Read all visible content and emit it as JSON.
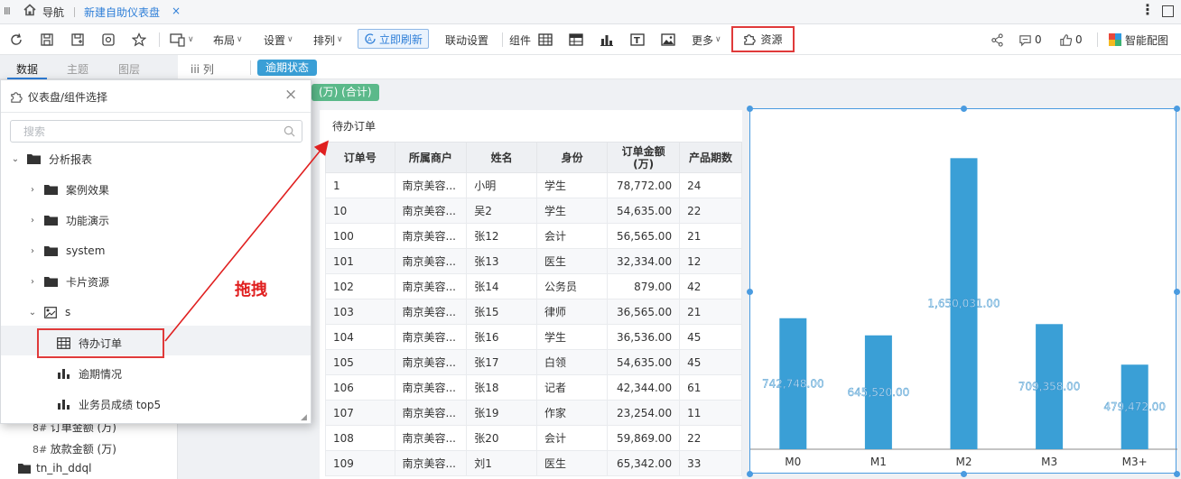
{
  "titlebar": {
    "nav_label": "导航",
    "tab_label": "新建自助仪表盘",
    "tab_close": "×"
  },
  "toolbar": {
    "layout": "布局",
    "settings": "设置",
    "arrange": "排列",
    "refresh": "立即刷新",
    "linkage": "联动设置",
    "component": "组件",
    "more": "更多",
    "resources": "资源",
    "comment_count": "0",
    "like_count": "0",
    "smart_color": "智能配图"
  },
  "subtabs": [
    "数据",
    "主题",
    "图层"
  ],
  "fields_band": {
    "column_label": "iii 列",
    "overdue_chip": "逾期状态",
    "green_chip": "(万) (合计)"
  },
  "left_panel": {
    "field_order_amount": "订单金额 (万)",
    "field_loan_amount": "放款金额 (万)",
    "folder_name": "tn_ih_ddql"
  },
  "popup": {
    "title": "仪表盘/组件选择",
    "close": "×",
    "search_placeholder": "搜索",
    "tree": {
      "root": "分析报表",
      "children": [
        "案例效果",
        "功能演示",
        "system",
        "卡片资源"
      ],
      "s_folder": "s",
      "s_children": [
        "待办订单",
        "逾期情况",
        "业务员成绩 top5"
      ]
    }
  },
  "annotation": {
    "drag_label": "拖拽"
  },
  "table_widget": {
    "title": "待办订单",
    "headers": [
      "订单号",
      "所属商户",
      "姓名",
      "身份",
      "订单金额\n(万)",
      "产品期数"
    ],
    "rows": [
      [
        "1",
        "南京美容...",
        "小明",
        "学生",
        "78,772.00",
        "24"
      ],
      [
        "10",
        "南京美容...",
        "吴2",
        "学生",
        "54,635.00",
        "22"
      ],
      [
        "100",
        "南京美容...",
        "张12",
        "会计",
        "56,565.00",
        "21"
      ],
      [
        "101",
        "南京美容...",
        "张13",
        "医生",
        "32,334.00",
        "12"
      ],
      [
        "102",
        "南京美容...",
        "张14",
        "公务员",
        "879.00",
        "42"
      ],
      [
        "103",
        "南京美容...",
        "张15",
        "律师",
        "36,565.00",
        "21"
      ],
      [
        "104",
        "南京美容...",
        "张16",
        "学生",
        "36,536.00",
        "45"
      ],
      [
        "105",
        "南京美容...",
        "张17",
        "白领",
        "54,635.00",
        "45"
      ],
      [
        "106",
        "南京美容...",
        "张18",
        "记者",
        "42,344.00",
        "61"
      ],
      [
        "107",
        "南京美容...",
        "张19",
        "作家",
        "23,254.00",
        "11"
      ],
      [
        "108",
        "南京美容...",
        "张20",
        "会计",
        "59,869.00",
        "22"
      ],
      [
        "109",
        "南京美容...",
        "刘1",
        "医生",
        "65,342.00",
        "33"
      ]
    ]
  },
  "chart_data": {
    "type": "bar",
    "categories": [
      "M0",
      "M1",
      "M2",
      "M3",
      "M3+"
    ],
    "values": [
      742748,
      645520,
      1650031,
      709358,
      479472
    ],
    "labels": [
      "742,748.00",
      "645,520.00",
      "1,650,031.00",
      "709,358.00",
      "479,472.00"
    ],
    "ylim": [
      0,
      1800000
    ],
    "grid": false,
    "bar_color": "#3a9fd6",
    "label_color": "#cfe8f8"
  }
}
